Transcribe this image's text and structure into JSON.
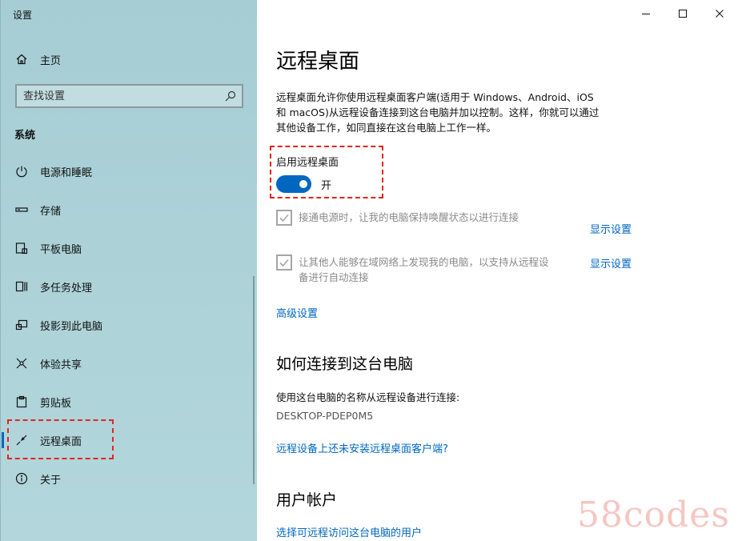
{
  "window": {
    "title": "设置",
    "controls": {
      "minimize": "minimize",
      "maximize": "maximize",
      "close": "close"
    }
  },
  "sidebar": {
    "home_label": "主页",
    "search_placeholder": "查找设置",
    "section_title": "系统",
    "items": [
      {
        "label": "电源和睡眠",
        "icon": "power-icon"
      },
      {
        "label": "存储",
        "icon": "storage-icon"
      },
      {
        "label": "平板电脑",
        "icon": "tablet-icon"
      },
      {
        "label": "多任务处理",
        "icon": "multitasking-icon"
      },
      {
        "label": "投影到此电脑",
        "icon": "projecting-icon"
      },
      {
        "label": "体验共享",
        "icon": "shared-experiences-icon"
      },
      {
        "label": "剪贴板",
        "icon": "clipboard-icon"
      },
      {
        "label": "远程桌面",
        "icon": "remote-desktop-icon",
        "selected": true
      },
      {
        "label": "关于",
        "icon": "info-icon"
      }
    ]
  },
  "main": {
    "title": "远程桌面",
    "description_line1": "远程桌面允许你使用远程桌面客户端(适用于 Windows、Android、iOS",
    "description_line2": "和 macOS)从远程设备连接到这台电脑并加以控制。这样，你就可以通过",
    "description_line3": "其他设备工作，如同直接在这台电脑上工作一样。",
    "toggle": {
      "label": "启用远程桌面",
      "state_text": "开",
      "on": true
    },
    "options": [
      {
        "line1": "接通电源时，让我的电脑保持唤醒状态以进行连接",
        "line2": "",
        "checked": true,
        "link": "显示设置"
      },
      {
        "line1": "让其他人能够在域网络上发现我的电脑，以支持从远程设",
        "line2": "备进行自动连接",
        "checked": true,
        "link": "显示设置"
      }
    ],
    "advanced_link": "高级设置",
    "connect_section": {
      "title": "如何连接到这台电脑",
      "text": "使用这台电脑的名称从远程设备进行连接:",
      "pc_name": "DESKTOP-PDEP0M5",
      "client_link": "远程设备上还未安装远程桌面客户端?"
    },
    "accounts_section": {
      "title": "用户帐户",
      "link": "选择可远程访问这台电脑的用户"
    }
  },
  "watermark": "58codes",
  "colors": {
    "accent": "#0067c0",
    "highlight_box": "#e0261f",
    "sidebar_bg": "#a6cdd4"
  }
}
